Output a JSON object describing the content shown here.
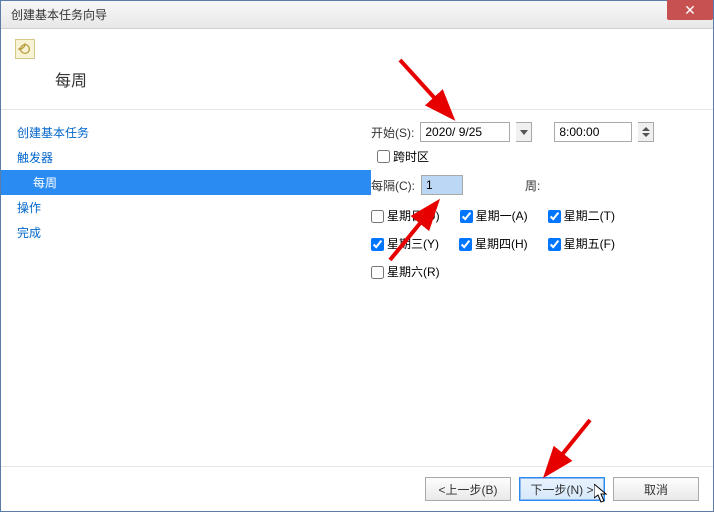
{
  "window": {
    "title": "创建基本任务向导"
  },
  "header": {
    "title": "每周"
  },
  "sidebar": {
    "items": [
      {
        "label": "创建基本任务"
      },
      {
        "label": "触发器"
      },
      {
        "label": "每周",
        "selected": true,
        "sub": true
      },
      {
        "label": "操作"
      },
      {
        "label": "完成"
      }
    ]
  },
  "form": {
    "start_label": "开始(S):",
    "date_value": "2020/ 9/25",
    "time_value": "8:00:00",
    "crosstz_label": "跨时区",
    "crosstz_checked": false,
    "interval_label": "每隔(C):",
    "interval_value": "1",
    "weeks_label": "周:",
    "days": [
      {
        "label": "星期日(U)",
        "checked": false
      },
      {
        "label": "星期一(A)",
        "checked": true
      },
      {
        "label": "星期二(T)",
        "checked": true
      },
      {
        "label": "星期三(Y)",
        "checked": true
      },
      {
        "label": "星期四(H)",
        "checked": true
      },
      {
        "label": "星期五(F)",
        "checked": true
      },
      {
        "label": "星期六(R)",
        "checked": false
      }
    ]
  },
  "footer": {
    "back": "<上一步(B)",
    "next": "下一步(N) >",
    "cancel": "取消"
  }
}
